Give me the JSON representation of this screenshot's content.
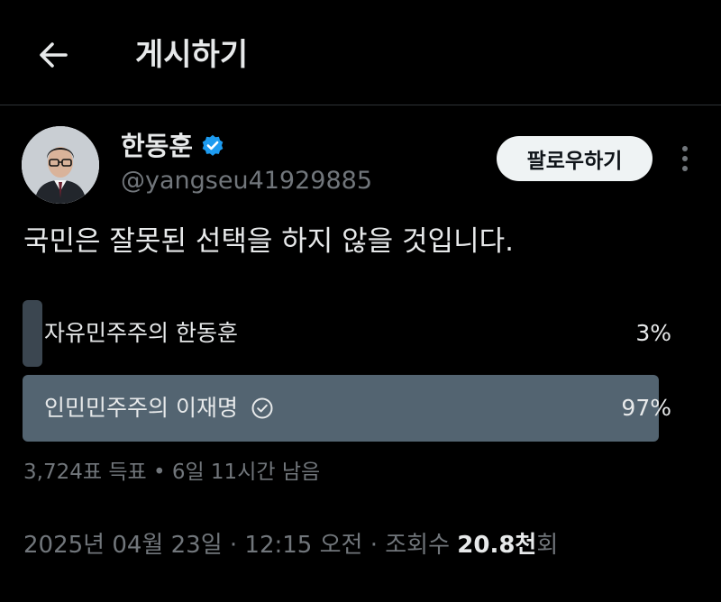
{
  "header": {
    "title": "게시하기",
    "back_icon": "arrow-left-icon"
  },
  "author": {
    "display_name": "한동훈",
    "handle": "@yangseu41929885",
    "verified": true,
    "verified_color": "#1d9bf0",
    "follow_label": "팔로우하기",
    "more_icon": "more-vertical-icon"
  },
  "tweet": {
    "text": "국민은 잘못된 선택을 하지 않을 것입니다."
  },
  "poll": {
    "options": [
      {
        "label": "자유민주주의 한동훈",
        "percent_text": "3%",
        "percent": 3,
        "selected": false
      },
      {
        "label": "인민민주주의 이재명",
        "percent_text": "97%",
        "percent": 97,
        "selected": true
      }
    ],
    "meta": "3,724표 득표 • 6일 11시간 남음"
  },
  "tweet_meta": {
    "timestamp": "2025년 04월 23일 · 12:15 오전 · 조회수 ",
    "views": "20.8천",
    "views_suffix": "회"
  },
  "colors": {
    "background": "#000000",
    "text": "#e7e9ea",
    "muted": "#71767b",
    "poll_winner": "#536471",
    "poll_loser": "#3b4650"
  }
}
